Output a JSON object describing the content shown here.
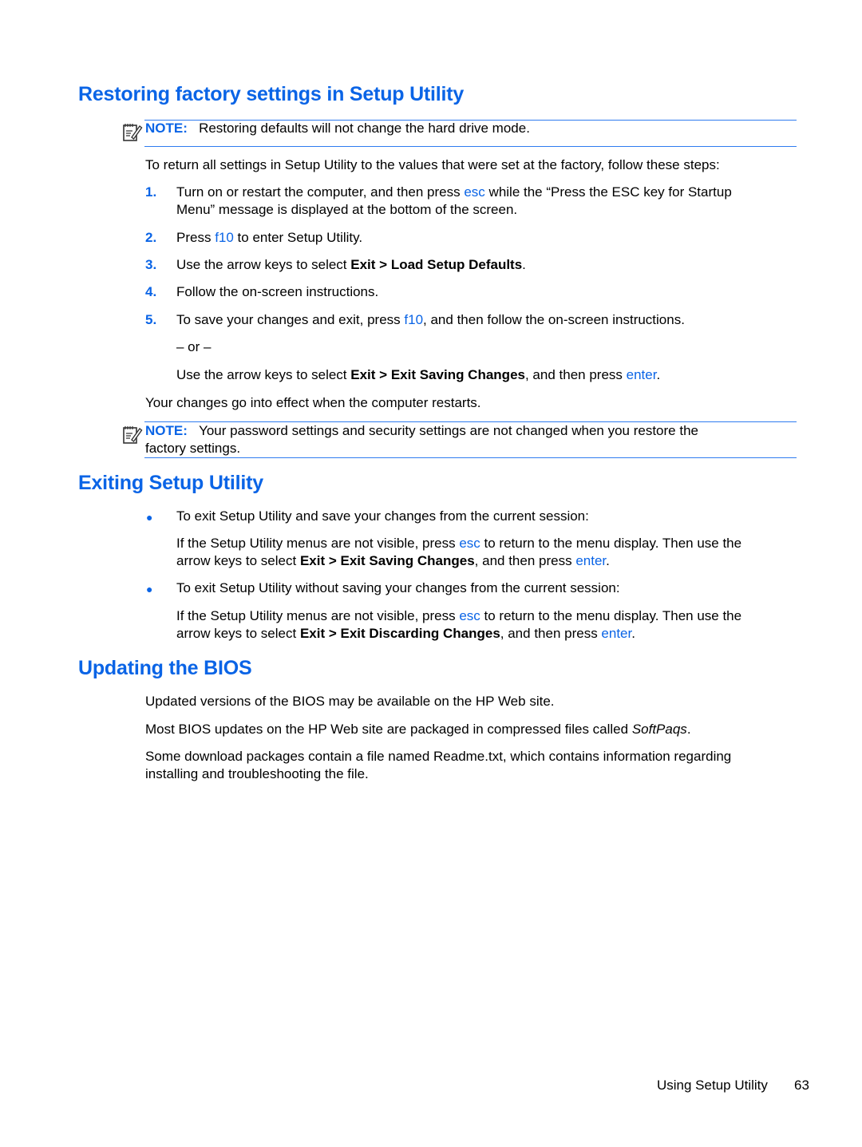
{
  "colors": {
    "accent": "#0a64e6",
    "rule": "#2f7cf0",
    "text": "#000000"
  },
  "sections": [
    {
      "heading": "Restoring factory settings in Setup Utility",
      "note1": {
        "label": "NOTE:",
        "text": "Restoring defaults will not change the hard drive mode.",
        "icon": "note-pencil-icon"
      },
      "intro": "To return all settings in Setup Utility to the values that were set at the factory, follow these steps:",
      "steps": [
        {
          "num": "1.",
          "a": "Turn on or restart the computer, and then press ",
          "key": "esc",
          "b": " while the “Press the ESC key for Startup",
          "line2": "Menu” message is displayed at the bottom of the screen."
        },
        {
          "num": "2.",
          "a": "Press ",
          "key": "f10",
          "b": " to enter Setup Utility."
        },
        {
          "num": "3.",
          "a": "Use the arrow keys to select ",
          "bold": "Exit > Load Setup Defaults",
          "b": "."
        },
        {
          "num": "4.",
          "a": "Follow the on-screen instructions."
        },
        {
          "num": "5.",
          "a": "To save your changes and exit, press ",
          "key": "f10",
          "b": ", and then follow the on-screen instructions."
        }
      ],
      "or": "– or –",
      "alt": {
        "a": "Use the arrow keys to select ",
        "bold": "Exit > Exit Saving Changes",
        "b": ", and then press ",
        "key": "enter",
        "c": "."
      },
      "outro": "Your changes go into effect when the computer restarts.",
      "note2": {
        "label": "NOTE:",
        "line1": "Your password settings and security settings are not changed when you restore the",
        "line2": "factory settings.",
        "icon": "note-pencil-icon"
      }
    },
    {
      "heading": "Exiting Setup Utility",
      "bullets": [
        {
          "text": "To exit Setup Utility and save your changes from the current session:",
          "p1a": "If the Setup Utility menus are not visible, press ",
          "key1": "esc",
          "p1b": " to return to the menu display. Then use the",
          "p2a": "arrow keys to select ",
          "bold": "Exit > Exit Saving Changes",
          "p2b": ", and then press ",
          "key2": "enter",
          "p2c": "."
        },
        {
          "text": "To exit Setup Utility without saving your changes from the current session:",
          "p1a": "If the Setup Utility menus are not visible, press ",
          "key1": "esc",
          "p1b": " to return to the menu display. Then use the",
          "p2a": "arrow keys to select ",
          "bold": "Exit > Exit Discarding Changes",
          "p2b": ", and then press ",
          "key2": "enter",
          "p2c": "."
        }
      ]
    },
    {
      "heading": "Updating the BIOS",
      "p1": "Updated versions of the BIOS may be available on the HP Web site.",
      "p2a": "Most BIOS updates on the HP Web site are packaged in compressed files called ",
      "p2italic": "SoftPaqs",
      "p2b": ".",
      "p3line1": "Some download packages contain a file named Readme.txt, which contains information regarding",
      "p3line2": "installing and troubleshooting the file."
    }
  ],
  "footer": {
    "section": "Using Setup Utility",
    "page": "63"
  }
}
